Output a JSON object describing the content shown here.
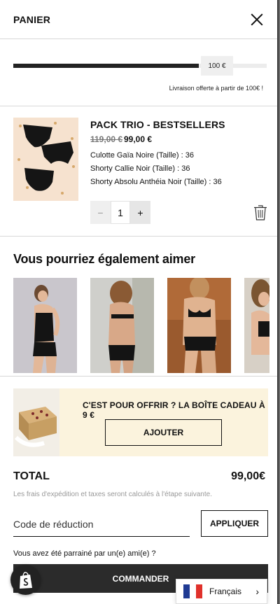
{
  "header": {
    "title": "PANIER"
  },
  "shipping": {
    "threshold_label": "100 €",
    "progress": 0.99,
    "note": "Livraison offerte à partir de 100€ !"
  },
  "cart_item": {
    "name": "PACK TRIO - BESTSELLERS",
    "price_old": "119,00 €",
    "price_new": "99,00 €",
    "variants": [
      "Culotte Gaïa Noire (Taille) : 36",
      "Shorty Callie Noir (Taille) : 36",
      "Shorty Absolu Anthéia Noir (Taille) : 36"
    ],
    "quantity": "1",
    "minus_glyph": "−",
    "plus_glyph": "+"
  },
  "recommendations": {
    "title": "Vous pourriez également aimer"
  },
  "gift": {
    "text": "C'EST POUR OFFRIR ? LA BOÎTE CADEAU À 9 €",
    "button": "AJOUTER"
  },
  "summary": {
    "total_label": "TOTAL",
    "total_value": "99,00€",
    "fees_note": "Les frais d'expédition et taxes seront calculés à l'étape suivante."
  },
  "discount": {
    "placeholder": "Code de réduction",
    "apply": "APPLIQUER"
  },
  "referral": "Vous avez été parrainé par un(e) ami(e) ?",
  "checkout": "COMMANDER",
  "language": {
    "label": "Français",
    "flag_colors": [
      "#1f3a93",
      "#ffffff",
      "#e0312b"
    ]
  },
  "colors": {
    "accent_dark": "#2b2b2b",
    "gift_bg": "#fbf3dd",
    "thumb_bg": "#f6e2cf"
  }
}
